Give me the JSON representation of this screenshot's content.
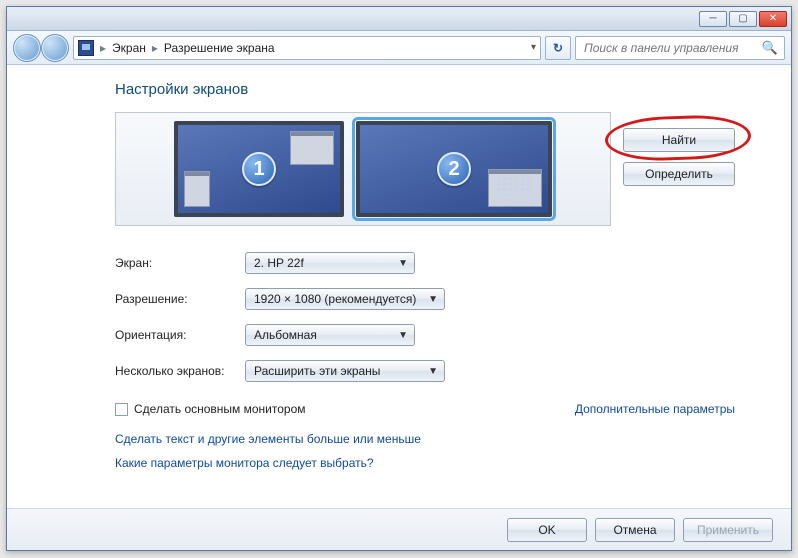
{
  "titlebar": {
    "minimize_glyph": "─",
    "maximize_glyph": "▢",
    "close_glyph": "✕"
  },
  "breadcrumb": {
    "item1": "Экран",
    "item2": "Разрешение экрана",
    "sep": "▸",
    "refresh_glyph": "↻",
    "dropdown_glyph": "▾"
  },
  "search": {
    "placeholder": "Поиск в панели управления"
  },
  "page_title": "Настройки экранов",
  "monitors": {
    "m1_badge": "1",
    "m2_badge": "2"
  },
  "side_buttons": {
    "detect": "Найти",
    "identify": "Определить"
  },
  "form": {
    "display_label": "Экран:",
    "display_value": "2. HP 22f",
    "resolution_label": "Разрешение:",
    "resolution_value": "1920 × 1080 (рекомендуется)",
    "orientation_label": "Ориентация:",
    "orientation_value": "Альбомная",
    "multi_label": "Несколько экранов:",
    "multi_value": "Расширить эти экраны"
  },
  "checkbox_label": "Сделать основным монитором",
  "links": {
    "advanced": "Дополнительные параметры",
    "textsize": "Сделать текст и другие элементы больше или меньше",
    "which": "Какие параметры монитора следует выбрать?"
  },
  "footer": {
    "ok": "OK",
    "cancel": "Отмена",
    "apply": "Применить"
  }
}
